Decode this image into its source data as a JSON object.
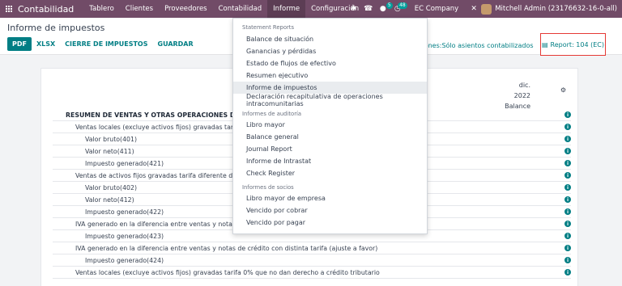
{
  "navbar": {
    "brand": "Contabilidad",
    "menu": [
      "Tablero",
      "Clientes",
      "Proveedores",
      "Contabilidad",
      "Informe",
      "Configuración"
    ],
    "active_menu": "Informe",
    "chat_count": "5",
    "activity_count": "48",
    "company": "EC Company",
    "user": "Mitchell Admin (23176632-16-0-all)"
  },
  "control_panel": {
    "title": "Informe de impuestos",
    "buttons": [
      "PDF",
      "XLSX",
      "CIERRE DE IMPUESTOS",
      "GUARDAR"
    ],
    "options_text": "pciones:Sólo asientos contabilizados",
    "report_label": "Report: 104 (EC)"
  },
  "report": {
    "column_header": [
      "dic.",
      "2022",
      "Balance"
    ],
    "rows": [
      {
        "label": "RESUMEN DE VENTAS Y OTRAS OPERACIONES DEL PE",
        "level": 0
      },
      {
        "label": "Ventas locales (excluye activos fijos) gravadas tarifa di",
        "level": 1
      },
      {
        "label": "Valor bruto(401)",
        "level": 2
      },
      {
        "label": "Valor neto(411)",
        "level": 2
      },
      {
        "label": "Impuesto generado(421)",
        "level": 2
      },
      {
        "label": "Ventas de activos fijos gravadas tarifa diferente de cer",
        "level": 1
      },
      {
        "label": "Valor bruto(402)",
        "level": 2
      },
      {
        "label": "Valor neto(412)",
        "level": 2
      },
      {
        "label": "Impuesto generado(422)",
        "level": 2
      },
      {
        "label": "IVA generado en la diferencia entre ventas y notas de c",
        "level": 1
      },
      {
        "label": "Impuesto generado(423)",
        "level": 2
      },
      {
        "label": "IVA generado en la diferencia entre ventas y notas de crédito con distinta tarifa (ajuste a favor)",
        "level": 1
      },
      {
        "label": "Impuesto generado(424)",
        "level": 2
      },
      {
        "label": "Ventas locales (excluye activos fijos) gravadas tarifa 0% que no dan derecho a crédito tributario",
        "level": 1
      }
    ]
  },
  "dropdown": {
    "sections": [
      {
        "title": "Statement Reports",
        "items": [
          "Balance de situación",
          "Ganancias y pérdidas",
          "Estado de flujos de efectivo",
          "Resumen ejecutivo",
          "Informe de impuestos",
          "Declaración recapitulativa de operaciones intracomunitarias"
        ]
      },
      {
        "title": "Informes de auditoría",
        "items": [
          "Libro mayor",
          "Balance general",
          "Journal Report",
          "Informe de Intrastat",
          "Check Register"
        ]
      },
      {
        "title": "Informes de socios",
        "items": [
          "Libro mayor de empresa",
          "Vencido por cobrar",
          "Vencido por pagar"
        ]
      }
    ],
    "highlighted": "Informe de impuestos"
  },
  "icons": {
    "apps": "apps-grid-icon",
    "bug": "bug-icon",
    "phone": "phone-icon",
    "chat": "chat-icon",
    "clock": "clock-icon",
    "tools": "tools-icon",
    "book": "book-icon",
    "info": "info-icon",
    "gear": "gear-icon"
  },
  "colors": {
    "navbar": "#714b67",
    "primary": "#017e84",
    "highlight_border": "#e53935"
  }
}
